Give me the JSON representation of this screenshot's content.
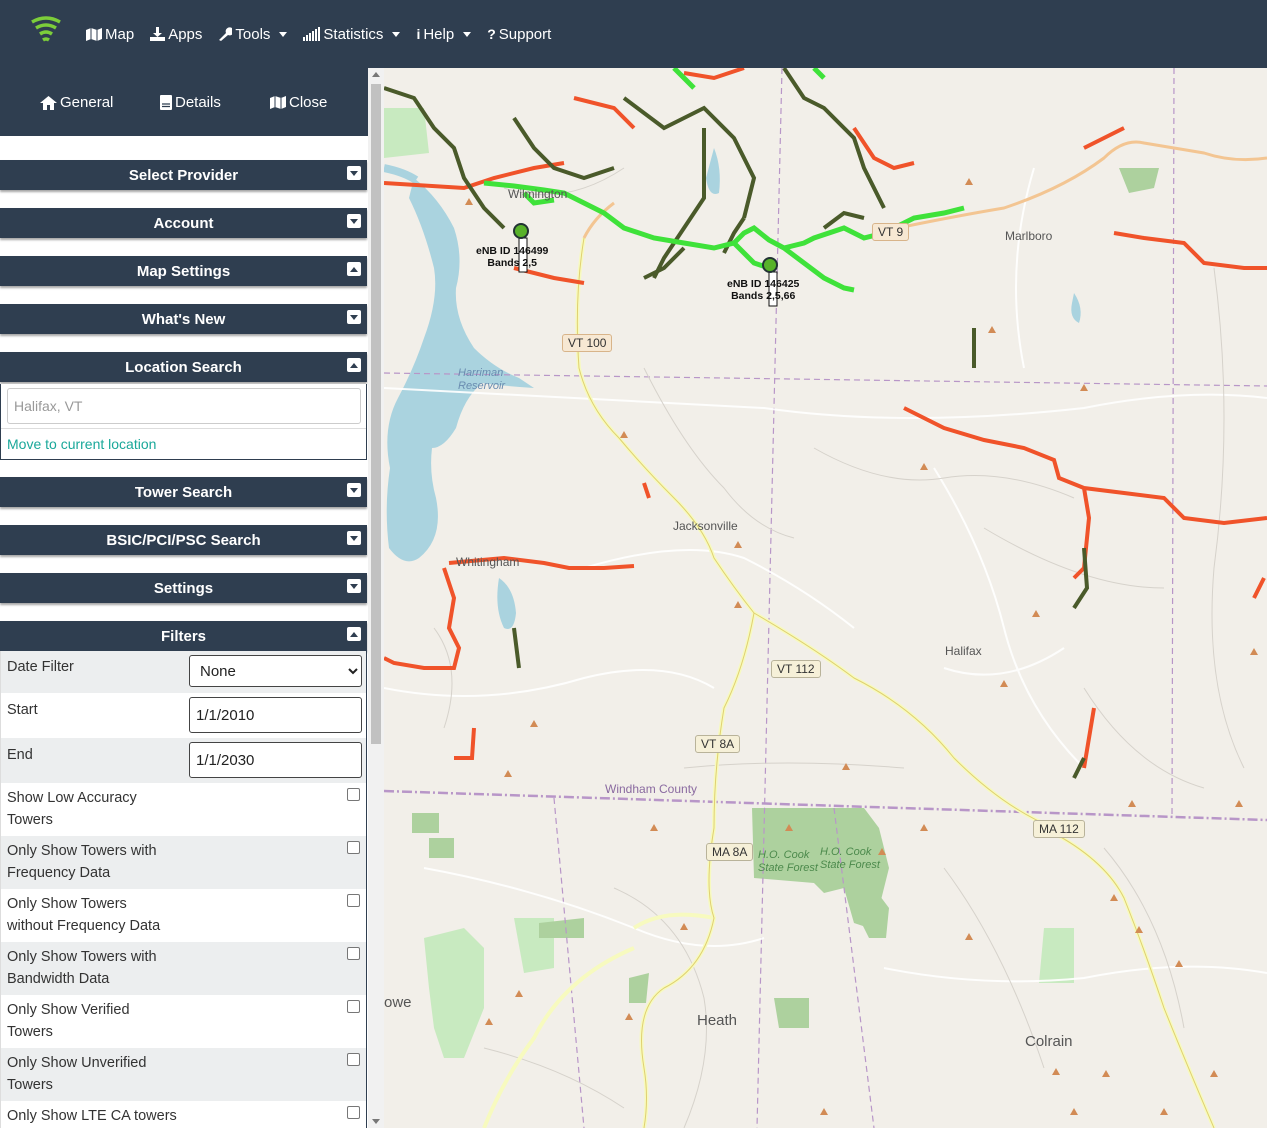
{
  "navbar": {
    "items": [
      {
        "label": "Map",
        "icon": "map-icon",
        "dropdown": false
      },
      {
        "label": "Apps",
        "icon": "download-icon",
        "dropdown": false
      },
      {
        "label": "Tools",
        "icon": "wrench-icon",
        "dropdown": true
      },
      {
        "label": "Statistics",
        "icon": "signal-bars-icon",
        "dropdown": true
      },
      {
        "label": "Help",
        "icon": "info-icon",
        "dropdown": true
      },
      {
        "label": "Support",
        "icon": "question-icon",
        "dropdown": false
      }
    ],
    "logo_color": "#7ccd3a"
  },
  "sidebar": {
    "tabs": [
      {
        "label": "General",
        "icon": "home-icon"
      },
      {
        "label": "Details",
        "icon": "document-icon"
      },
      {
        "label": "Close",
        "icon": "map-icon"
      }
    ],
    "panels": {
      "select_provider": "Select Provider",
      "account": "Account",
      "map_settings": "Map Settings",
      "whats_new": "What's New",
      "location_search": "Location Search",
      "tower_search": "Tower Search",
      "bsic_search": "BSIC/PCI/PSC Search",
      "settings": "Settings",
      "filters": "Filters"
    },
    "location_search": {
      "placeholder": "Halifax, VT",
      "move_link": "Move to current location"
    },
    "filters": {
      "date_filter_label": "Date Filter",
      "date_filter_value": "None",
      "date_filter_options": [
        "None"
      ],
      "start_label": "Start",
      "start_value": "1/1/2010",
      "end_label": "End",
      "end_value": "1/1/2030",
      "checkboxes": [
        {
          "line1": "Show Low Accuracy",
          "line2": "Towers",
          "checked": false
        },
        {
          "line1": "Only Show Towers with",
          "line2": "Frequency Data",
          "checked": false
        },
        {
          "line1": "Only Show Towers",
          "line2": "without Frequency Data",
          "checked": false
        },
        {
          "line1": "Only Show Towers with",
          "line2": "Bandwidth Data",
          "checked": false
        },
        {
          "line1": "Only Show Verified",
          "line2": "Towers",
          "checked": false
        },
        {
          "line1": "Only Show Unverified",
          "line2": "Towers",
          "checked": false
        },
        {
          "line1": "Only Show LTE CA towers",
          "line2": "",
          "checked": false
        }
      ]
    }
  },
  "map": {
    "towns": {
      "wilmington": "Wilmington",
      "marlboro": "Marlboro",
      "jacksonville": "Jacksonville",
      "whitingham": "Whitingham",
      "halifax": "Halifax",
      "heath": "Heath",
      "colrain": "Colrain",
      "rowe": "owe"
    },
    "routes": {
      "vt100": "VT 100",
      "vt9": "VT 9",
      "vt112": "VT 112",
      "vt8a": "VT 8A",
      "ma8a": "MA 8A",
      "ma112": "MA 112"
    },
    "water": {
      "harriman1": "Harriman",
      "harriman2": "Reservoir"
    },
    "forest": {
      "hocook1a": "H.O. Cook",
      "hocook1b": "State Forest",
      "hocook2a": "H.O. Cook",
      "hocook2b": "State Forest"
    },
    "county": "Windham County",
    "enb": [
      {
        "id_text": "eNB ID 146499",
        "bands": "Bands 2,5"
      },
      {
        "id_text": "eNB ID 146425",
        "bands": "Bands 2,5,66"
      }
    ],
    "colors": {
      "coverage_strong": "#3fe23a",
      "coverage_dark": "#4a5a2a",
      "coverage_weak": "#f0532a",
      "water": "#aad3df",
      "forest": "#add19e",
      "background": "#f2efe9",
      "panel_header": "#2f3e50"
    }
  }
}
